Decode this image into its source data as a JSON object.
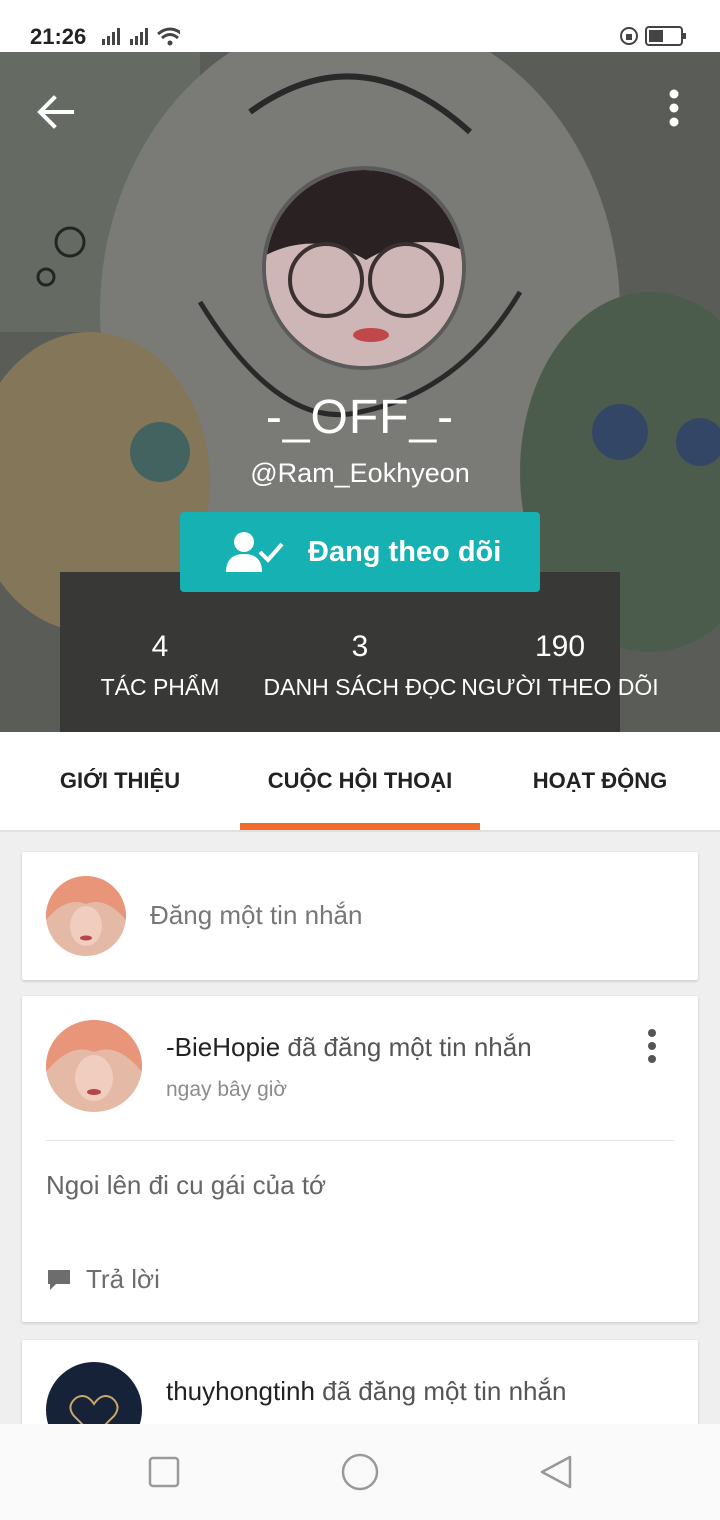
{
  "status_bar": {
    "time": "21:26"
  },
  "profile": {
    "display_name": "-_OFF_-",
    "username": "@Ram_Eokhyeon",
    "follow_button_label": "Đang theo dõi",
    "stats": [
      {
        "value": "4",
        "label": "TÁC PHẨM"
      },
      {
        "value": "3",
        "label": "DANH SÁCH ĐỌC"
      },
      {
        "value": "190",
        "label": "NGƯỜI THEO DÕI"
      }
    ]
  },
  "tabs": [
    {
      "label": "GIỚI THIỆU"
    },
    {
      "label": "CUỘC HỘI THOẠI",
      "active": true
    },
    {
      "label": "HOẠT ĐỘNG"
    }
  ],
  "composer": {
    "placeholder": "Đăng một tin nhắn"
  },
  "posts": [
    {
      "username": "-BieHopie",
      "action": " đã đăng một tin nhắn",
      "time": "ngay bây giờ",
      "message": "Ngoi lên đi cu gái của tớ",
      "reply_label": "Trả lời"
    },
    {
      "username": "thuyhongtinh",
      "action": " đã đăng một tin nhắn"
    }
  ],
  "colors": {
    "accent": "#f26a2c",
    "follow": "#16b1b2"
  },
  "icons": [
    "back-arrow-icon",
    "more-vert-icon",
    "follow-check-icon",
    "comment-icon",
    "nav-recent-icon",
    "nav-home-icon",
    "nav-back-icon"
  ]
}
